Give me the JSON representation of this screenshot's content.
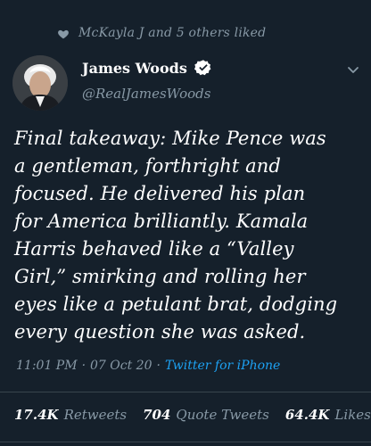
{
  "social_context": {
    "liked_by_text": "McKayla J and 5 others liked",
    "icon": "heart-icon"
  },
  "author": {
    "name": "James Woods",
    "handle": "@RealJamesWoods",
    "verified": true,
    "verified_icon": "verified-badge-icon"
  },
  "tweet": {
    "text": "Final takeaway: Mike Pence was\na gentleman, forthright and\nfocused. He delivered his plan\nfor America brilliantly. Kamala\nHarris behaved like a “Valley\nGirl,” smirking and rolling her\neyes like a petulant brat, dodging\nevery question she was asked."
  },
  "meta": {
    "time": "11:01 PM",
    "separator1": "·",
    "date": "07 Oct 20",
    "separator2": "·",
    "source": "Twitter for iPhone"
  },
  "stats": {
    "retweets_count": "17.4K",
    "retweets_label": "Retweets",
    "quote_count": "704",
    "quote_label": "Quote Tweets",
    "likes_count": "64.4K",
    "likes_label": "Likes"
  },
  "colors": {
    "background": "#15202b",
    "muted": "#8899a6",
    "accent": "#1da1f2",
    "text": "#ffffff"
  }
}
